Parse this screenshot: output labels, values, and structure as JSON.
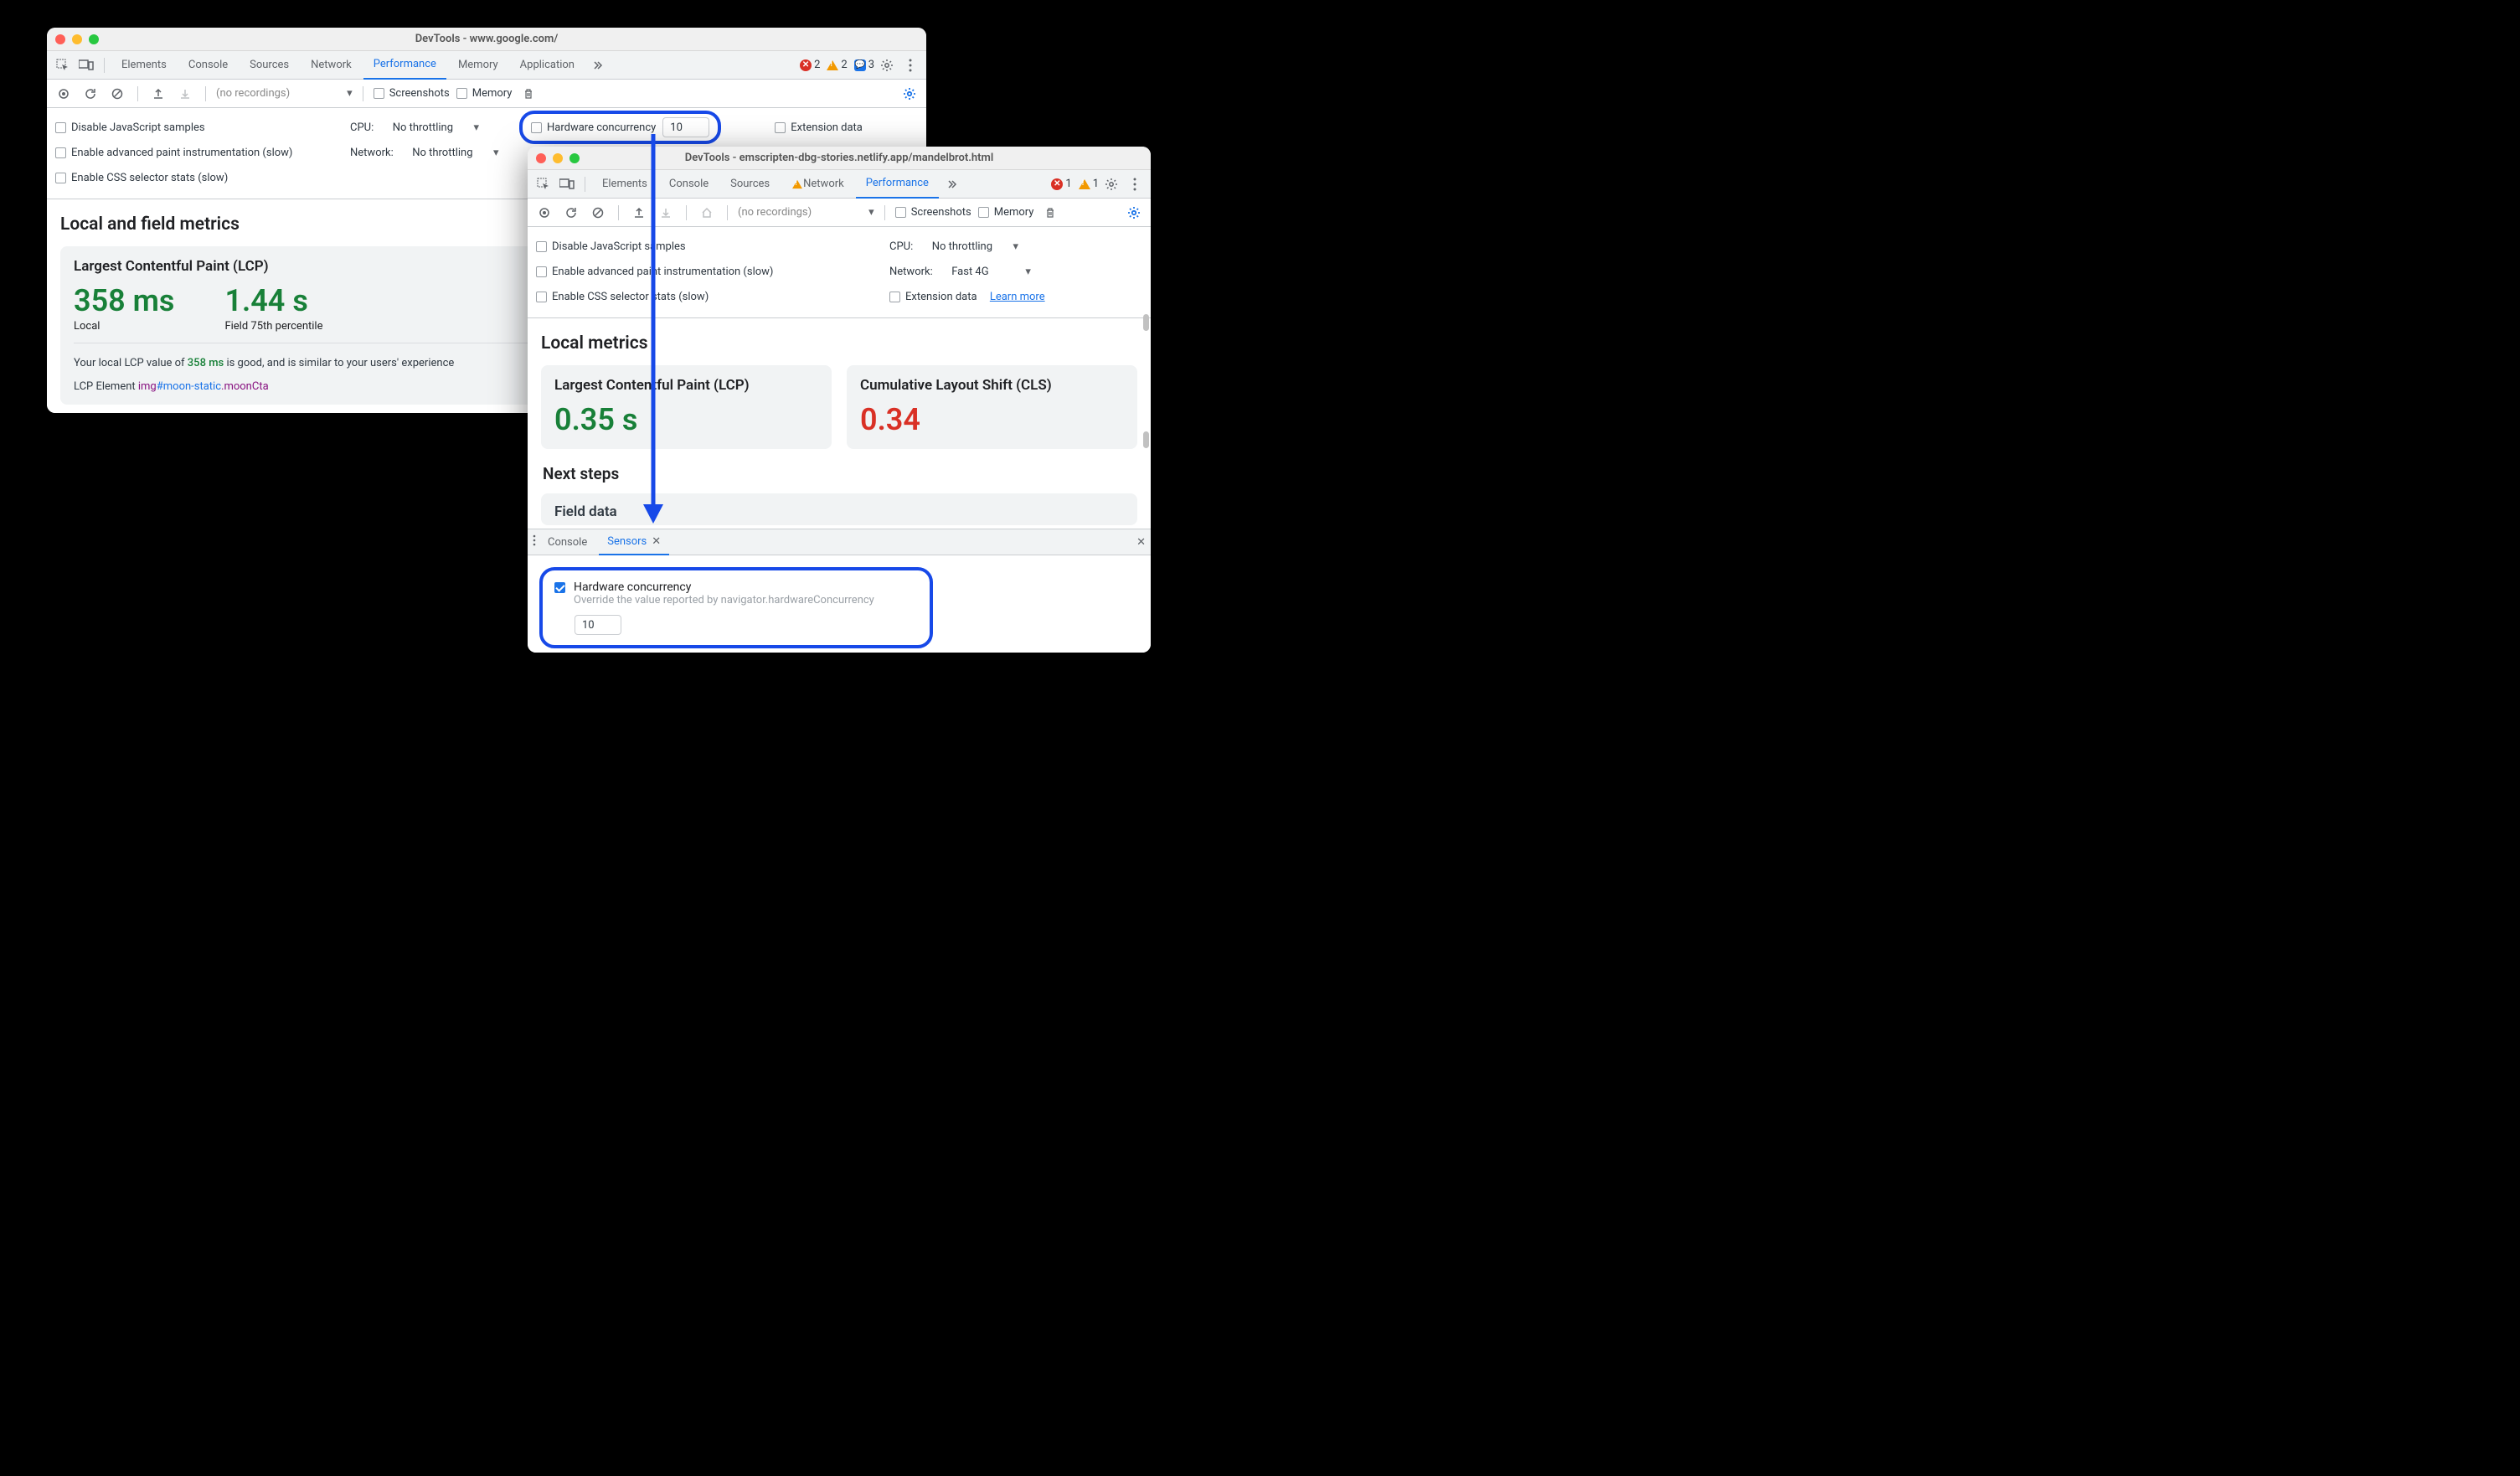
{
  "window1": {
    "title": "DevTools - www.google.com/",
    "tabs": [
      "Elements",
      "Console",
      "Sources",
      "Network",
      "Performance",
      "Memory",
      "Application"
    ],
    "activeTab": "Performance",
    "counts": {
      "errors": "2",
      "warnings": "2",
      "info": "3"
    },
    "recordings_placeholder": "(no recordings)",
    "screenshots_label": "Screenshots",
    "memory_label": "Memory",
    "settings": {
      "disable_js": "Disable JavaScript samples",
      "enable_paint": "Enable advanced paint instrumentation (slow)",
      "enable_css": "Enable CSS selector stats (slow)",
      "cpu_label": "CPU:",
      "cpu_value": "No throttling",
      "network_label": "Network:",
      "network_value": "No throttling",
      "hw_label": "Hardware concurrency",
      "hw_value": "10",
      "ext_label": "Extension data"
    },
    "metrics": {
      "heading": "Local and field metrics",
      "lcp_title": "Largest Contentful Paint (LCP)",
      "local_val": "358 ms",
      "local_label": "Local",
      "field_val": "1.44 s",
      "field_label": "Field 75th percentile",
      "desc_pre": "Your local LCP value of ",
      "desc_val": "358 ms",
      "desc_post": " is good, and is similar to your users' experience",
      "lcp_el_label": "LCP Element  ",
      "lcp_el_tag": "img",
      "lcp_el_id": "#moon-static",
      "lcp_el_class": ".moonCta"
    }
  },
  "window2": {
    "title": "DevTools - emscripten-dbg-stories.netlify.app/mandelbrot.html",
    "tabs": [
      "Elements",
      "Console",
      "Sources",
      "Network",
      "Performance"
    ],
    "activeTab": "Performance",
    "warnTab": "Network",
    "counts": {
      "errors": "1",
      "warnings": "1"
    },
    "recordings_placeholder": "(no recordings)",
    "screenshots_label": "Screenshots",
    "memory_label": "Memory",
    "settings": {
      "disable_js": "Disable JavaScript samples",
      "enable_paint": "Enable advanced paint instrumentation (slow)",
      "enable_css": "Enable CSS selector stats (slow)",
      "cpu_label": "CPU:",
      "cpu_value": "No throttling",
      "network_label": "Network:",
      "network_value": "Fast 4G",
      "ext_label": "Extension data",
      "learn_more": "Learn more"
    },
    "metrics": {
      "heading": "Local metrics",
      "lcp_title": "Largest Contentful Paint (LCP)",
      "lcp_val": "0.35 s",
      "cls_title": "Cumulative Layout Shift (CLS)",
      "cls_val": "0.34",
      "next_steps": "Next steps",
      "field_data": "Field data"
    },
    "drawer": {
      "console": "Console",
      "sensors": "Sensors",
      "hw_title": "Hardware concurrency",
      "hw_sub": "Override the value reported by navigator.hardwareConcurrency",
      "hw_value": "10"
    }
  }
}
